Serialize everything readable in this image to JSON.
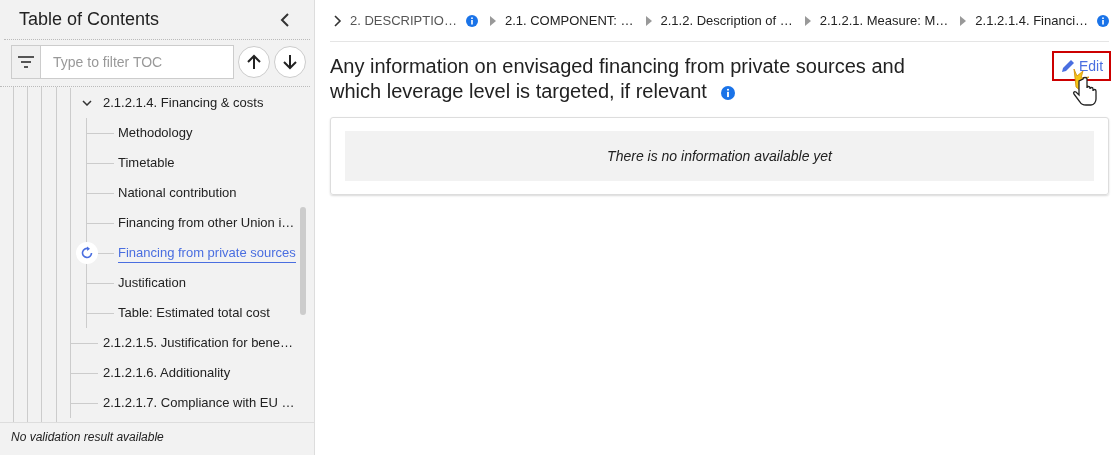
{
  "sidebar": {
    "title": "Table of Contents",
    "filter": {
      "placeholder": "Type to filter TOC"
    },
    "items": [
      {
        "label": "2.1.2.1.4. Financing & costs",
        "selected": false,
        "expanded": true,
        "children": [
          {
            "label": "Methodology",
            "selected": false
          },
          {
            "label": "Timetable",
            "selected": false
          },
          {
            "label": "National contribution",
            "selected": false
          },
          {
            "label": "Financing from other Union i…",
            "selected": false
          },
          {
            "label": "Financing from private sources",
            "selected": true
          },
          {
            "label": "Justification",
            "selected": false
          },
          {
            "label": "Table: Estimated total cost",
            "selected": false
          }
        ]
      },
      {
        "label": "2.1.2.1.5. Justification for bene…",
        "selected": false
      },
      {
        "label": "2.1.2.1.6. Additionality",
        "selected": false
      },
      {
        "label": "2.1.2.1.7. Compliance with EU …",
        "selected": false
      }
    ],
    "footer": "No validation result available"
  },
  "breadcrumb": [
    {
      "label": "2. DESCRIPTIO…",
      "info": true
    },
    {
      "label": "2.1. COMPONENT: …",
      "info": false
    },
    {
      "label": "2.1.2. Description of …",
      "info": false
    },
    {
      "label": "2.1.2.1. Measure: M…",
      "info": false
    },
    {
      "label": "2.1.2.1.4. Financi…",
      "info": true
    }
  ],
  "section": {
    "title": "Any information on envisaged financing from private sources and which leverage level is targeted, if relevant",
    "edit": "Edit",
    "empty_message": "There is no information available yet"
  }
}
